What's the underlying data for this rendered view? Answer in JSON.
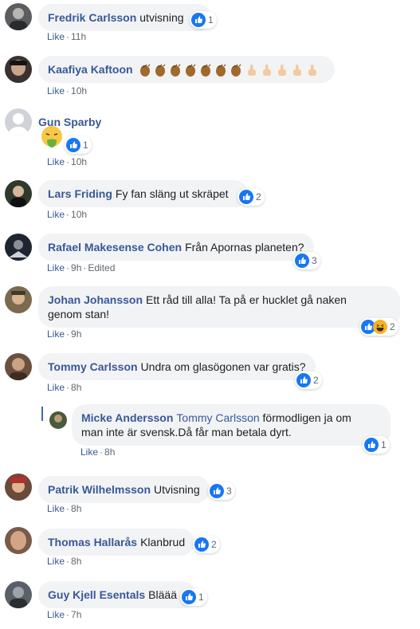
{
  "meta_like": "Like",
  "comments": [
    {
      "author": "Fredrik Carlsson",
      "text": "utvisning",
      "time": "11h",
      "reactions": "1",
      "avatar_color": "#5b5d60"
    },
    {
      "author": "Kaafiya Kaftoon",
      "text": "",
      "time": "10h",
      "reactions": "",
      "avatar_color": "#3a3230",
      "emoji_icons": [
        "clapping-hands-icon",
        "clapping-hands-icon",
        "clapping-hands-icon",
        "clapping-hands-icon",
        "clapping-hands-icon",
        "clapping-hands-icon",
        "clapping-hands-icon",
        "pointing-hand-icon",
        "pointing-hand-icon",
        "pointing-hand-icon",
        "pointing-hand-icon",
        "pointing-hand-icon"
      ]
    },
    {
      "author": "Gun Sparby",
      "text": "",
      "time": "10h",
      "reactions": "1",
      "avatar_color": "#cfd3d9",
      "sticker": "nauseated-face-icon"
    },
    {
      "author": "Lars Friding",
      "text": "Fy fan släng ut skräpet",
      "time": "10h",
      "reactions": "2",
      "avatar_color": "#2f3a2d"
    },
    {
      "author": "Rafael Makesense Cohen",
      "text": "Från Apornas planeten?",
      "time": "9h",
      "edited": "Edited",
      "reactions": "3",
      "avatar_color": "#1f2530"
    },
    {
      "author": "Johan Johansson",
      "text": "Ett råd till alla! Ta på er hucklet gå naken",
      "text2": "genom stan!",
      "time": "9h",
      "reactions": "2",
      "avatar_color": "#7b6a4e"
    },
    {
      "author": "Tommy Carlsson",
      "text": "Undra om glasögonen var gratis?",
      "time": "8h",
      "reactions": "2",
      "avatar_color": "#6b5040"
    },
    {
      "author": "Micke Andersson",
      "mention": "Tommy Carlsson",
      "text": "förmodligen ja om",
      "text2": "man inte är svensk.Då får man betala dyrt.",
      "time": "8h",
      "reactions": "1",
      "avatar_color": "#4a5a3a"
    },
    {
      "author": "Patrik Wilhelmsson",
      "text": "Utvisning",
      "time": "8h",
      "reactions": "3",
      "avatar_color": "#6a4a3a"
    },
    {
      "author": "Thomas Hallarås",
      "text": "Klanbrud",
      "time": "8h",
      "reactions": "2",
      "avatar_color": "#7a5a4a"
    },
    {
      "author": "Guy Kjell Esentals",
      "text": "Bläää",
      "time": "7h",
      "reactions": "1",
      "avatar_color": "#5a6068"
    }
  ],
  "colors": {
    "link": "#385898",
    "bubble": "#f2f3f5",
    "meta": "#606770",
    "like_blue": "#1877f2"
  }
}
